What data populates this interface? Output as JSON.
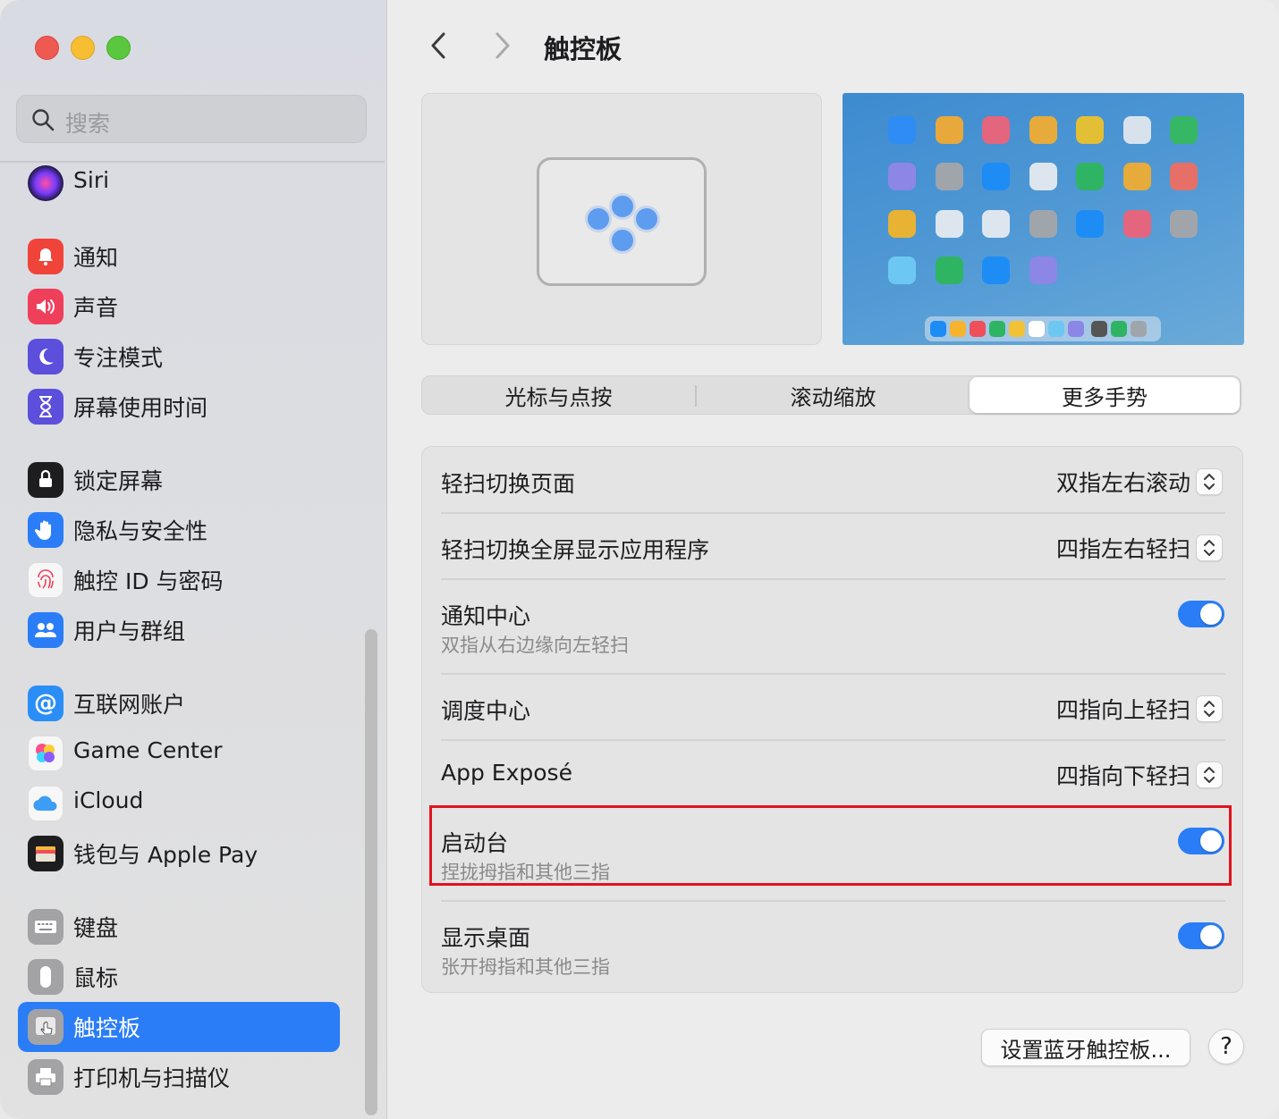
{
  "window": {
    "traffic_lights": [
      "close",
      "minimize",
      "zoom"
    ]
  },
  "search": {
    "placeholder": "搜索"
  },
  "sidebar": {
    "items": [
      {
        "label": "Siri",
        "icon": "siri-icon",
        "color": "#1a1a2e"
      },
      {
        "label": "通知",
        "icon": "bell-icon",
        "color": "#f0443a"
      },
      {
        "label": "声音",
        "icon": "speaker-icon",
        "color": "#ef3f5b"
      },
      {
        "label": "专注模式",
        "icon": "moon-icon",
        "color": "#5b4fdc"
      },
      {
        "label": "屏幕使用时间",
        "icon": "hourglass-icon",
        "color": "#5b4fdc"
      },
      {
        "label": "锁定屏幕",
        "icon": "lock-icon",
        "color": "#1d1d1f"
      },
      {
        "label": "隐私与安全性",
        "icon": "hand-icon",
        "color": "#2a7df6"
      },
      {
        "label": "触控 ID 与密码",
        "icon": "fingerprint-icon",
        "color": "#f5f5f5"
      },
      {
        "label": "用户与群组",
        "icon": "users-icon",
        "color": "#2a7df6"
      },
      {
        "label": "互联网账户",
        "icon": "at-icon",
        "color": "#2a8ef6"
      },
      {
        "label": "Game Center",
        "icon": "game-center-icon",
        "color": "#f5f5f5"
      },
      {
        "label": "iCloud",
        "icon": "cloud-icon",
        "color": "#f5f5f5"
      },
      {
        "label": "钱包与 Apple Pay",
        "icon": "wallet-icon",
        "color": "#1d1d1f"
      },
      {
        "label": "键盘",
        "icon": "keyboard-icon",
        "color": "#9a9a9a"
      },
      {
        "label": "鼠标",
        "icon": "mouse-icon",
        "color": "#9a9a9a"
      },
      {
        "label": "触控板",
        "icon": "trackpad-icon",
        "color": "#9a9a9a"
      },
      {
        "label": "打印机与扫描仪",
        "icon": "printer-icon",
        "color": "#9a9a9a"
      }
    ],
    "active": "触控板"
  },
  "header": {
    "title": "触控板",
    "back_icon": "chevron-left-icon",
    "forward_icon": "chevron-right-icon"
  },
  "tabs": [
    {
      "label": "光标与点按",
      "selected": false
    },
    {
      "label": "滚动缩放",
      "selected": false
    },
    {
      "label": "更多手势",
      "selected": true
    }
  ],
  "settings": [
    {
      "title": "轻扫切换页面",
      "control": "popup",
      "value": "双指左右滚动"
    },
    {
      "title": "轻扫切换全屏显示应用程序",
      "control": "popup",
      "value": "四指左右轻扫"
    },
    {
      "title": "通知中心",
      "subtitle": "双指从右边缘向左轻扫",
      "control": "toggle",
      "on": true
    },
    {
      "title": "调度中心",
      "control": "popup",
      "value": "四指向上轻扫"
    },
    {
      "title": "App Exposé",
      "control": "popup",
      "value": "四指向下轻扫"
    },
    {
      "title": "启动台",
      "subtitle": "捏拢拇指和其他三指",
      "control": "toggle",
      "on": true
    },
    {
      "title": "显示桌面",
      "subtitle": "张开拇指和其他三指",
      "control": "toggle",
      "on": true
    }
  ],
  "footer": {
    "bluetooth_button": "设置蓝牙触控板...",
    "help_button": "?"
  },
  "colors": {
    "accent": "#2a7df6",
    "highlight_box": "#e1121d"
  }
}
